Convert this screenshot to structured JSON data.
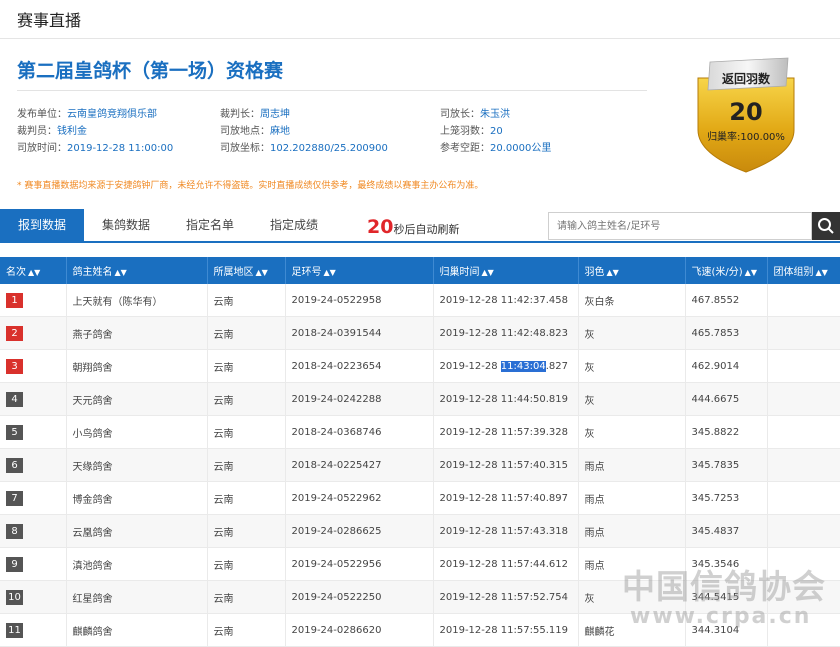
{
  "header": {
    "title": "赛事直播"
  },
  "race": {
    "title": "第二届皇鸽杯（第一场）资格赛"
  },
  "info": {
    "publisher_label": "发布单位：",
    "publisher": "云南皇鸽竞翔俱乐部",
    "referee_label": "裁判员：",
    "referee": "钱利金",
    "release_time_label": "司放时间：",
    "release_time": "2019-12-28 11:00:00",
    "chief_referee_label": "裁判长：",
    "chief_referee": "周志坤",
    "release_place_label": "司放地点：",
    "release_place": "麻地",
    "release_coord_label": "司放坐标：",
    "release_coord": "102.202880/25.200900",
    "release_chief_label": "司放长：",
    "release_chief": "朱玉洪",
    "basket_count_label": "上笼羽数：",
    "basket_count": "20",
    "ref_distance_label": "参考空距：",
    "ref_distance": "20.0000公里"
  },
  "notice": "* 赛事直播数据均来源于安捷鸽钟厂商，未经允许不得盗链。实时直播成绩仅供参考，最终成绩以赛事主办公布为准。",
  "badge": {
    "label": "返回羽数",
    "count": "20",
    "rate": "归巢率:100.00%"
  },
  "tabs": [
    "报到数据",
    "集鸽数据",
    "指定名单",
    "指定成绩"
  ],
  "refresh": {
    "seconds": "20",
    "text": "秒后自动刷新"
  },
  "search": {
    "placeholder": "请输入鸽主姓名/足环号"
  },
  "table": {
    "headers": [
      "名次",
      "鸽主姓名",
      "所属地区",
      "足环号",
      "归巢时间",
      "羽色",
      "飞速(米/分)",
      "团体组别"
    ],
    "rows": [
      {
        "rank": "1",
        "owner": "上天就有（陈华有）",
        "region": "云南",
        "ring": "2019-24-0522958",
        "time_a": "2019-12-28 11:42:37.458",
        "time_sel": "",
        "time_b": "",
        "color": "灰白条",
        "speed": "467.8552",
        "group": ""
      },
      {
        "rank": "2",
        "owner": "燕子鸽舍",
        "region": "云南",
        "ring": "2018-24-0391544",
        "time_a": "2019-12-28 11:42:48.823",
        "time_sel": "",
        "time_b": "",
        "color": "灰",
        "speed": "465.7853",
        "group": ""
      },
      {
        "rank": "3",
        "owner": "朝翔鸽舍",
        "region": "云南",
        "ring": "2018-24-0223654",
        "time_a": "2019-12-28 ",
        "time_sel": "11:43:04",
        "time_b": ".827",
        "color": "灰",
        "speed": "462.9014",
        "group": ""
      },
      {
        "rank": "4",
        "owner": "天元鸽舍",
        "region": "云南",
        "ring": "2019-24-0242288",
        "time_a": "2019-12-28 11:44:50.819",
        "time_sel": "",
        "time_b": "",
        "color": "灰",
        "speed": "444.6675",
        "group": ""
      },
      {
        "rank": "5",
        "owner": "小鸟鸽舍",
        "region": "云南",
        "ring": "2018-24-0368746",
        "time_a": "2019-12-28 11:57:39.328",
        "time_sel": "",
        "time_b": "",
        "color": "灰",
        "speed": "345.8822",
        "group": ""
      },
      {
        "rank": "6",
        "owner": "天缘鸽舍",
        "region": "云南",
        "ring": "2018-24-0225427",
        "time_a": "2019-12-28 11:57:40.315",
        "time_sel": "",
        "time_b": "",
        "color": "雨点",
        "speed": "345.7835",
        "group": ""
      },
      {
        "rank": "7",
        "owner": "博金鸽舍",
        "region": "云南",
        "ring": "2019-24-0522962",
        "time_a": "2019-12-28 11:57:40.897",
        "time_sel": "",
        "time_b": "",
        "color": "雨点",
        "speed": "345.7253",
        "group": ""
      },
      {
        "rank": "8",
        "owner": "云凰鸽舍",
        "region": "云南",
        "ring": "2019-24-0286625",
        "time_a": "2019-12-28 11:57:43.318",
        "time_sel": "",
        "time_b": "",
        "color": "雨点",
        "speed": "345.4837",
        "group": ""
      },
      {
        "rank": "9",
        "owner": "滇池鸽舍",
        "region": "云南",
        "ring": "2019-24-0522956",
        "time_a": "2019-12-28 11:57:44.612",
        "time_sel": "",
        "time_b": "",
        "color": "雨点",
        "speed": "345.3546",
        "group": ""
      },
      {
        "rank": "10",
        "owner": "红星鸽舍",
        "region": "云南",
        "ring": "2019-24-0522250",
        "time_a": "2019-12-28 11:57:52.754",
        "time_sel": "",
        "time_b": "",
        "color": "灰",
        "speed": "344.5415",
        "group": ""
      },
      {
        "rank": "11",
        "owner": "麒麟鸽舍",
        "region": "云南",
        "ring": "2019-24-0286620",
        "time_a": "2019-12-28 11:57:55.119",
        "time_sel": "",
        "time_b": "",
        "color": "麒麟花",
        "speed": "344.3104",
        "group": ""
      }
    ]
  },
  "watermark": {
    "line1": "中国信鸽协会",
    "line2": "www.crpa.cn"
  },
  "colors": {
    "brand": "#1a6fc0",
    "rank_top": "#d9312c",
    "rank_rest": "#555555",
    "notice": "#f08a24",
    "refresh_num": "#e0262a"
  }
}
